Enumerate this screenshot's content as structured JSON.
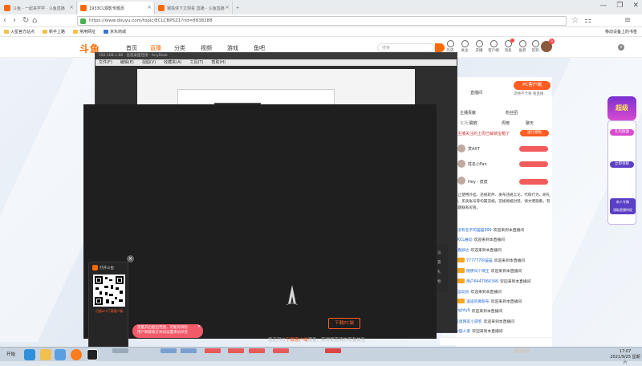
{
  "browser": {
    "tabs": [
      {
        "label": "斗鱼 - 一起来学学 · 斗鱼直播",
        "active": false
      },
      {
        "label": "1933CL观影专题页",
        "active": true
      },
      {
        "label": "钢铁侠下文观看 直播 - 斗鱼直播",
        "active": false
      }
    ],
    "window_controls": [
      "—",
      "❐",
      "✕"
    ],
    "url": "https://www.douyu.com/topic/ECLCBP5Z1?rid=8838288",
    "bookmarks": [
      "火星官方站点",
      "新手上路",
      "常用网址",
      "京东商城"
    ],
    "mobile_bookmark": "移动设备上的书签"
  },
  "douyu": {
    "logo": "斗鱼",
    "nav": [
      "首页",
      "直播",
      "分类",
      "视频",
      "游戏",
      "鱼吧"
    ],
    "search_placeholder": "搜索",
    "header_icons": [
      {
        "label": "历史",
        "badge": false
      },
      {
        "label": "关注",
        "badge": false
      },
      {
        "label": "开播",
        "badge": false
      },
      {
        "label": "客户端",
        "badge": false
      },
      {
        "label": "消息",
        "badge": true
      },
      {
        "label": "鱼券",
        "badge": false
      },
      {
        "label": "签到",
        "badge": false
      }
    ],
    "avatar_badge": "9"
  },
  "remote_window": {
    "title": "192.168.1.88 - 远程桌面连接 - AnyDesk",
    "menu": [
      "文件(F)",
      "编辑(E)",
      "视图(V)",
      "收藏夹(A)",
      "工具(T)",
      "帮助(H)"
    ]
  },
  "player": {
    "download_button": "下载PC端",
    "tip_prefix": "您还可以",
    "tip_link": "下载客户端",
    "tip_suffix": "观看，获得更高清的观看体验",
    "qr_title": "打开斗鱼",
    "qr_subtitle": "扫描APP下载客户端",
    "toast_line1": "流量开启超出范围，可能有风险",
    "toast_line2": "用户和接收方共同设置来访声音",
    "side_labels": [
      "设",
      "置",
      "礼",
      "物"
    ]
  },
  "right_panel": {
    "pc_client_button": "PC客户端",
    "pc_client_sub": "流畅不卡顿 看直播",
    "section_label": "直播间",
    "tabs": [
      "主播贡献",
      "粉丝团",
      "贵宾",
      "周榜"
    ],
    "chat_tab": "聊天",
    "contribution_title": "本场贡献",
    "host_line": "主播关注的上周已解锁宝箱了",
    "join_button": "送礼物啦",
    "ranks": [
      "赏AXT",
      "姓名小Fan",
      "Hey - 皮皮"
    ],
    "notice": "禁止使用外挂、违规软件、发布违规言论，代练行为、刷礼物，买卖账号等均属违规，违规将被封禁，请文明观看，有问题联系房管。",
    "welcome_text": "欢迎来到本直播间",
    "chat": [
      "没有名字的猫猫999",
      "KCL展动",
      "鑫颜达",
      "777777的猫猫",
      "随便叫个啊王",
      "用户6447966346",
      "运动员",
      "道道的撕裂布",
      "Nighty9",
      "皮蛋网友小游客",
      "中国人家"
    ]
  },
  "promo": {
    "title": "超级",
    "line1": "礼包放送",
    "line2": "立即领取",
    "line3": "新人专属",
    "line4": "领取直播特权"
  },
  "taskbar": {
    "start_label": "开始",
    "clock_time": "17:07",
    "clock_date": "2021/9/25 星期六"
  },
  "colors": {
    "accent": "#ff6a00",
    "danger": "#f25c5c",
    "link": "#2a6ed8"
  }
}
